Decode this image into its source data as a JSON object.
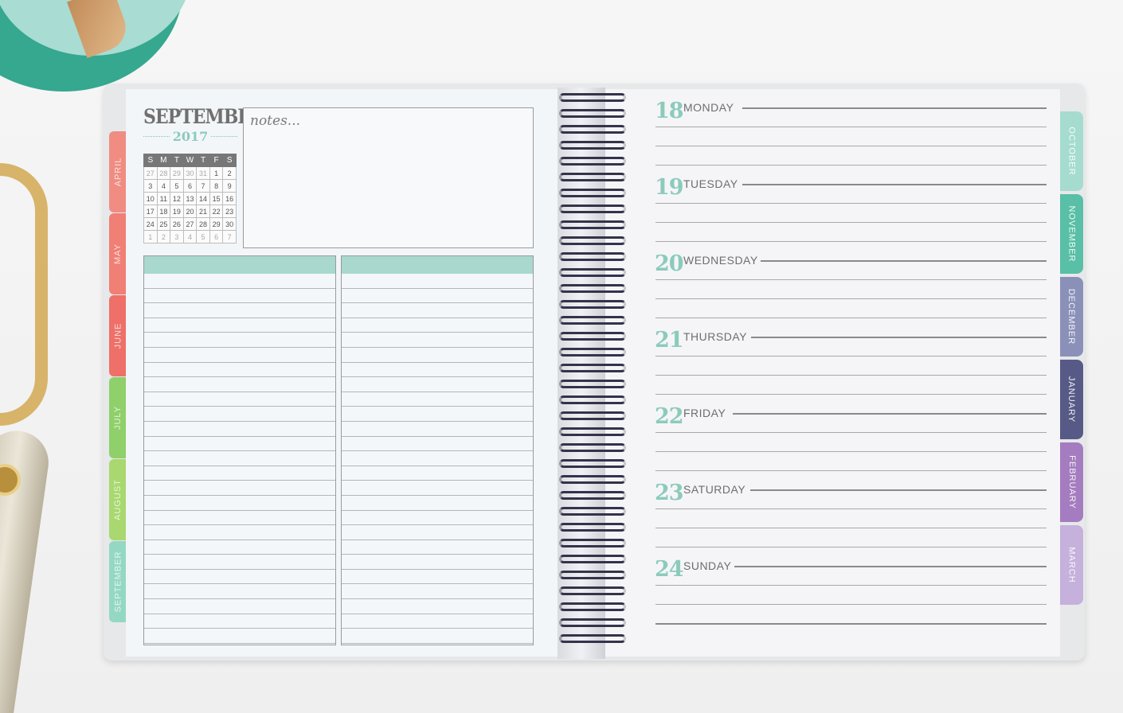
{
  "planner": {
    "month": "SEPTEMBER",
    "year": "2017",
    "notes_label": "notes...",
    "mini_calendar": {
      "weekdays": [
        "S",
        "M",
        "T",
        "W",
        "T",
        "F",
        "S"
      ],
      "weeks": [
        [
          "27",
          "28",
          "29",
          "30",
          "31",
          "1",
          "2"
        ],
        [
          "3",
          "4",
          "5",
          "6",
          "7",
          "8",
          "9"
        ],
        [
          "10",
          "11",
          "12",
          "13",
          "14",
          "15",
          "16"
        ],
        [
          "17",
          "18",
          "19",
          "20",
          "21",
          "22",
          "23"
        ],
        [
          "24",
          "25",
          "26",
          "27",
          "28",
          "29",
          "30"
        ],
        [
          "1",
          "2",
          "3",
          "4",
          "5",
          "6",
          "7"
        ]
      ]
    },
    "left_tabs": [
      {
        "label": "APRIL",
        "color": "#f08c82"
      },
      {
        "label": "MAY",
        "color": "#f07f75"
      },
      {
        "label": "JUNE",
        "color": "#ee7068"
      },
      {
        "label": "JULY",
        "color": "#8fd06a"
      },
      {
        "label": "AUGUST",
        "color": "#a8d86f"
      },
      {
        "label": "SEPTEMBER",
        "color": "#94d8c3"
      }
    ],
    "right_tabs": [
      {
        "label": "OCTOBER",
        "color": "#a5dccf"
      },
      {
        "label": "NOVEMBER",
        "color": "#59bfa6"
      },
      {
        "label": "DECEMBER",
        "color": "#8a90b8"
      },
      {
        "label": "JANUARY",
        "color": "#575a86"
      },
      {
        "label": "FEBRUARY",
        "color": "#a47cbf"
      },
      {
        "label": "MARCH",
        "color": "#c6b0dc"
      }
    ],
    "days": [
      {
        "num": "18",
        "name": "MONDAY"
      },
      {
        "num": "19",
        "name": "TUESDAY"
      },
      {
        "num": "20",
        "name": "WEDNESDAY"
      },
      {
        "num": "21",
        "name": "THURSDAY"
      },
      {
        "num": "22",
        "name": "FRIDAY"
      },
      {
        "num": "23",
        "name": "SATURDAY"
      },
      {
        "num": "24",
        "name": "SUNDAY"
      }
    ]
  }
}
